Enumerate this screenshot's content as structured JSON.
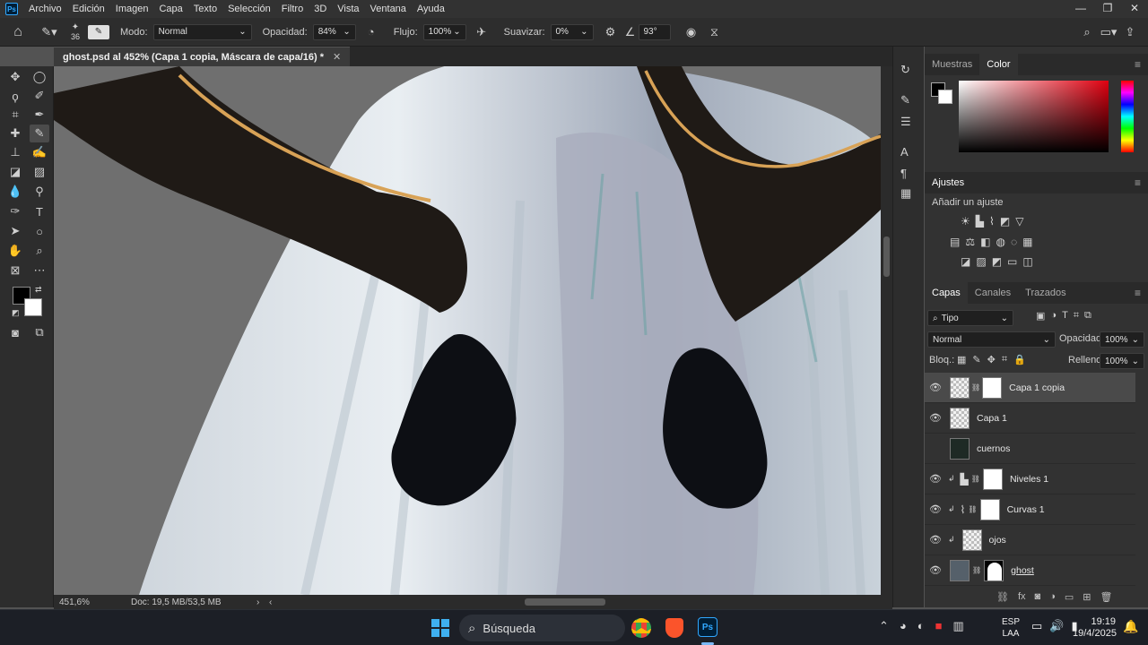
{
  "menubar": {
    "items": [
      "Archivo",
      "Edición",
      "Imagen",
      "Capa",
      "Texto",
      "Selección",
      "Filtro",
      "3D",
      "Vista",
      "Ventana",
      "Ayuda"
    ]
  },
  "options": {
    "brush_size": "36",
    "mode_label": "Modo:",
    "mode_value": "Normal",
    "opacity_label": "Opacidad:",
    "opacity_value": "84%",
    "flow_label": "Flujo:",
    "flow_value": "100%",
    "smooth_label": "Suavizar:",
    "smooth_value": "0%",
    "angle_value": "93°"
  },
  "document": {
    "tab_title": "ghost.psd al 452% (Capa 1 copia, Máscara de capa/16) *"
  },
  "status": {
    "zoom": "451,6%",
    "doc_size": "Doc: 19,5 MB/53,5 MB"
  },
  "panels": {
    "swatches_tab": "Muestras",
    "color_tab": "Color",
    "adjustments_title": "Ajustes",
    "add_adjustment": "Añadir un ajuste",
    "layers_tab": "Capas",
    "channels_tab": "Canales",
    "paths_tab": "Trazados",
    "filter_kind": "Tipo",
    "blend_mode": "Normal",
    "opacity_label": "Opacidad:",
    "opacity_value": "100%",
    "lock_label": "Bloq.:",
    "fill_label": "Relleno:",
    "fill_value": "100%",
    "layers": [
      {
        "name": "Capa 1 copia"
      },
      {
        "name": "Capa 1"
      },
      {
        "name": "cuernos"
      },
      {
        "name": "Niveles 1"
      },
      {
        "name": "Curvas 1"
      },
      {
        "name": "ojos"
      },
      {
        "name": "ghost"
      }
    ]
  },
  "taskbar": {
    "search_placeholder": "Búsqueda",
    "lang_top": "ESP",
    "lang_bottom": "LAA",
    "time": "19:19",
    "date": "19/4/2025"
  },
  "colors": {
    "ps_blue": "#31a8ff",
    "panel_bg": "#323232",
    "canvas_bg": "#6e6e6e"
  }
}
